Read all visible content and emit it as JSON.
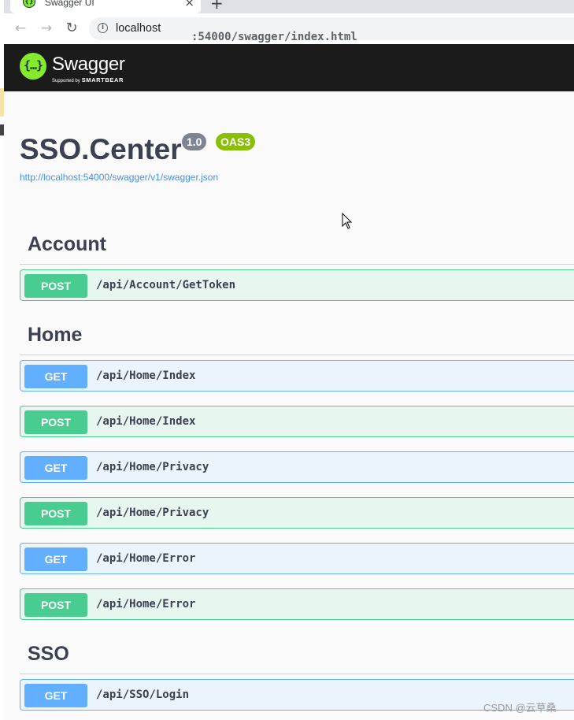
{
  "browser": {
    "tab_title": "Swagger UI",
    "tab_close": "×",
    "new_tab": "+",
    "url_host": "localhost",
    "url_path": ":54000/swagger/index.html",
    "back": "←",
    "forward": "→",
    "reload": "↻",
    "info": "i"
  },
  "topbar": {
    "logo_glyph": "{…}",
    "logo_text": "Swagger",
    "supported_by": "Supported by",
    "smartbear": "SMARTBEAR"
  },
  "info": {
    "title": "SSO.Center",
    "version": "1.0",
    "oas": "OAS3",
    "spec_url": "http://localhost:54000/swagger/v1/swagger.json"
  },
  "tags": [
    {
      "name": "Account",
      "operations": [
        {
          "method": "POST",
          "path": "/api/Account/GetToken"
        }
      ]
    },
    {
      "name": "Home",
      "operations": [
        {
          "method": "GET",
          "path": "/api/Home/Index"
        },
        {
          "method": "POST",
          "path": "/api/Home/Index"
        },
        {
          "method": "GET",
          "path": "/api/Home/Privacy"
        },
        {
          "method": "POST",
          "path": "/api/Home/Privacy"
        },
        {
          "method": "GET",
          "path": "/api/Home/Error"
        },
        {
          "method": "POST",
          "path": "/api/Home/Error"
        }
      ]
    },
    {
      "name": "SSO",
      "operations": [
        {
          "method": "GET",
          "path": "/api/SSO/Login"
        }
      ]
    }
  ],
  "watermark": "CSDN @云草桑",
  "colors": {
    "post": "#49cc90",
    "get": "#61affe",
    "swagger_green": "#85ea2d",
    "topbar": "#1b1b1b",
    "text": "#3b4151"
  }
}
